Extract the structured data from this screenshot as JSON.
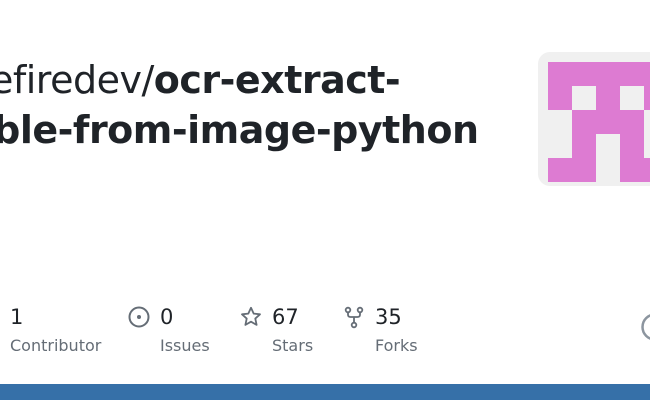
{
  "repo": {
    "owner_part": "vefiredev/",
    "name_line1": "ocr-extract-",
    "name_line2": "able-from-image-python"
  },
  "stats": {
    "contributors": {
      "value": "1",
      "label": "Contributor"
    },
    "issues": {
      "value": "0",
      "label": "Issues"
    },
    "stars": {
      "value": "67",
      "label": "Stars"
    },
    "forks": {
      "value": "35",
      "label": "Forks"
    }
  },
  "colors": {
    "avatar_pink": "#dd7bd2",
    "avatar_bg": "#f0f0f0",
    "bottom_bar": "#3670a8",
    "label_gray": "#656d76"
  },
  "icons": {
    "issues": "issue-opened-icon",
    "stars": "star-icon",
    "forks": "repo-forked-icon",
    "logo": "github-logo-icon"
  }
}
